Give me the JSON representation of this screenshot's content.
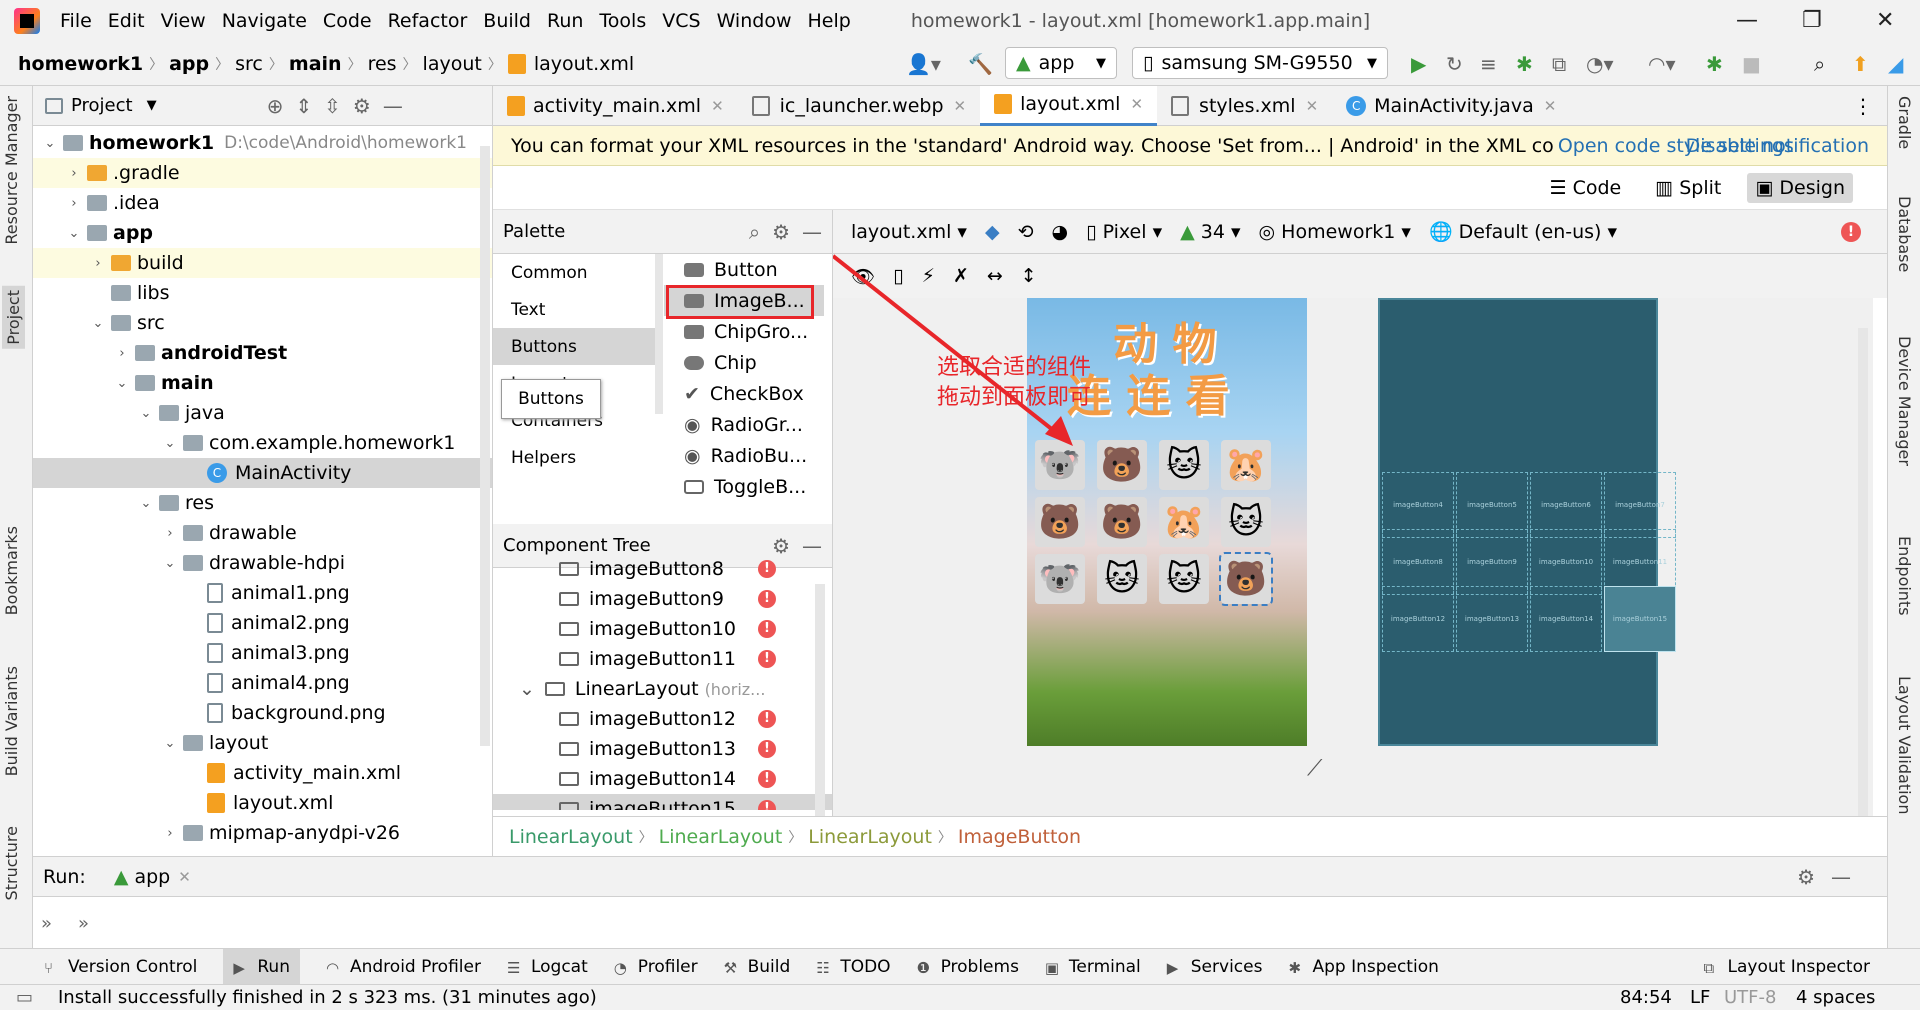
{
  "menu": {
    "items": [
      "File",
      "Edit",
      "View",
      "Navigate",
      "Code",
      "Refactor",
      "Build",
      "Run",
      "Tools",
      "VCS",
      "Window",
      "Help"
    ],
    "window_title": "homework1 - layout.xml [homework1.app.main]"
  },
  "nav": {
    "breadcrumbs": [
      "homework1",
      "app",
      "src",
      "main",
      "res",
      "layout",
      "layout.xml"
    ],
    "run_config": "app",
    "device": "samsung SM-G9550"
  },
  "left_strip": [
    "Resource Manager",
    "Project",
    "Bookmarks",
    "Build Variants",
    "Structure"
  ],
  "right_strip": [
    "Gradle",
    "Database",
    "Device Manager",
    "Endpoints",
    "Layout Validation"
  ],
  "project": {
    "header": "Project",
    "tree": [
      {
        "label": "homework1",
        "extra": "D:\\code\\Android\\homework1",
        "depth": 0,
        "open": true,
        "kind": "module",
        "bold": true
      },
      {
        "label": ".gradle",
        "depth": 1,
        "open": false,
        "kind": "orange"
      },
      {
        "label": ".idea",
        "depth": 1,
        "open": false,
        "kind": "folder"
      },
      {
        "label": "app",
        "depth": 1,
        "open": true,
        "kind": "module",
        "bold": true
      },
      {
        "label": "build",
        "depth": 2,
        "open": false,
        "kind": "orange"
      },
      {
        "label": "libs",
        "depth": 2,
        "kind": "folder"
      },
      {
        "label": "src",
        "depth": 2,
        "open": true,
        "kind": "folder"
      },
      {
        "label": "androidTest",
        "depth": 3,
        "open": false,
        "kind": "folder",
        "bold": true
      },
      {
        "label": "main",
        "depth": 3,
        "open": true,
        "kind": "folder",
        "bold": true
      },
      {
        "label": "java",
        "depth": 4,
        "open": true,
        "kind": "folder"
      },
      {
        "label": "com.example.homework1",
        "depth": 5,
        "open": true,
        "kind": "folder"
      },
      {
        "label": "MainActivity",
        "depth": 6,
        "kind": "class",
        "selected": true
      },
      {
        "label": "res",
        "depth": 4,
        "open": true,
        "kind": "folder"
      },
      {
        "label": "drawable",
        "depth": 5,
        "open": false,
        "kind": "folder"
      },
      {
        "label": "drawable-hdpi",
        "depth": 5,
        "open": true,
        "kind": "folder"
      },
      {
        "label": "animal1.png",
        "depth": 6,
        "kind": "file"
      },
      {
        "label": "animal2.png",
        "depth": 6,
        "kind": "file"
      },
      {
        "label": "animal3.png",
        "depth": 6,
        "kind": "file"
      },
      {
        "label": "animal4.png",
        "depth": 6,
        "kind": "file"
      },
      {
        "label": "background.png",
        "depth": 6,
        "kind": "file"
      },
      {
        "label": "layout",
        "depth": 5,
        "open": true,
        "kind": "folder"
      },
      {
        "label": "activity_main.xml",
        "depth": 6,
        "kind": "xml"
      },
      {
        "label": "layout.xml",
        "depth": 6,
        "kind": "xml"
      },
      {
        "label": "mipmap-anydpi-v26",
        "depth": 5,
        "open": false,
        "kind": "folder"
      }
    ]
  },
  "tabs": [
    "activity_main.xml",
    "ic_launcher.webp",
    "layout.xml",
    "styles.xml",
    "MainActivity.java"
  ],
  "notification": {
    "text": "You can format your XML resources in the 'standard' Android way. Choose 'Set from... | Android' in the XML co",
    "link1": "Open code style settings",
    "link2": "Disable notification"
  },
  "view_modes": [
    "Code",
    "Split",
    "Design"
  ],
  "palette": {
    "title": "Palette",
    "categories": [
      "Common",
      "Text",
      "Buttons",
      "Layouts",
      "Containers",
      "Helpers"
    ],
    "tooltip": "Buttons",
    "items": [
      "Button",
      "ImageB...",
      "ChipGro...",
      "Chip",
      "CheckBox",
      "RadioGr...",
      "RadioBu...",
      "ToggleB..."
    ]
  },
  "component_tree": {
    "title": "Component Tree",
    "rows": [
      {
        "label": "imageButton8",
        "depth": 1,
        "err": true
      },
      {
        "label": "imageButton9",
        "depth": 1,
        "err": true
      },
      {
        "label": "imageButton10",
        "depth": 1,
        "err": true
      },
      {
        "label": "imageButton11",
        "depth": 1,
        "err": true
      },
      {
        "label": "LinearLayout",
        "extra": "(horiz...",
        "depth": 0,
        "err": false
      },
      {
        "label": "imageButton12",
        "depth": 1,
        "err": true
      },
      {
        "label": "imageButton13",
        "depth": 1,
        "err": true
      },
      {
        "label": "imageButton14",
        "depth": 1,
        "err": true
      },
      {
        "label": "imageButton15",
        "depth": 1,
        "err": true,
        "selected": true
      }
    ]
  },
  "design_toolbar": {
    "file": "layout.xml",
    "device": "Pixel",
    "api": "34",
    "theme": "Homework1",
    "locale": "Default (en-us)"
  },
  "preview": {
    "title_line1": "动 物",
    "title_line2": "连 连 看",
    "grid": [
      "🐨",
      "🐻",
      "🐱",
      "🐹",
      "🐻",
      "🐻",
      "🐹",
      "🐱",
      "🐨",
      "🐱",
      "🐱",
      "🐻"
    ]
  },
  "blueprint_labels": [
    "imageButton4",
    "imageButton5",
    "imageButton6",
    "imageButton7",
    "imageButton8",
    "imageButton9",
    "imageButton10",
    "imageButton11",
    "imageButton12",
    "imageButton13",
    "imageButton14",
    "imageButton15"
  ],
  "annotation": {
    "line1": "选取合适的组件",
    "line2": "拖动到面板即可"
  },
  "breadcrumb_bottom": [
    "LinearLayout",
    "LinearLayout",
    "LinearLayout",
    "ImageButton"
  ],
  "run": {
    "label": "Run:",
    "config": "app"
  },
  "bottom_tools": [
    "Version Control",
    "Run",
    "Android Profiler",
    "Logcat",
    "Profiler",
    "Build",
    "TODO",
    "Problems",
    "Terminal",
    "Services",
    "App Inspection",
    "Layout Inspector"
  ],
  "status": {
    "message": "Install successfully finished in 2 s 323 ms. (31 minutes ago)",
    "position": "84:54",
    "line_sep": "LF",
    "encoding": "UTF-8",
    "indent": "4 spaces"
  },
  "colors": {
    "accent": "#4083c9",
    "error": "#e55555",
    "annotation": "#e8262a",
    "blueprint": "#2b5d6e"
  }
}
